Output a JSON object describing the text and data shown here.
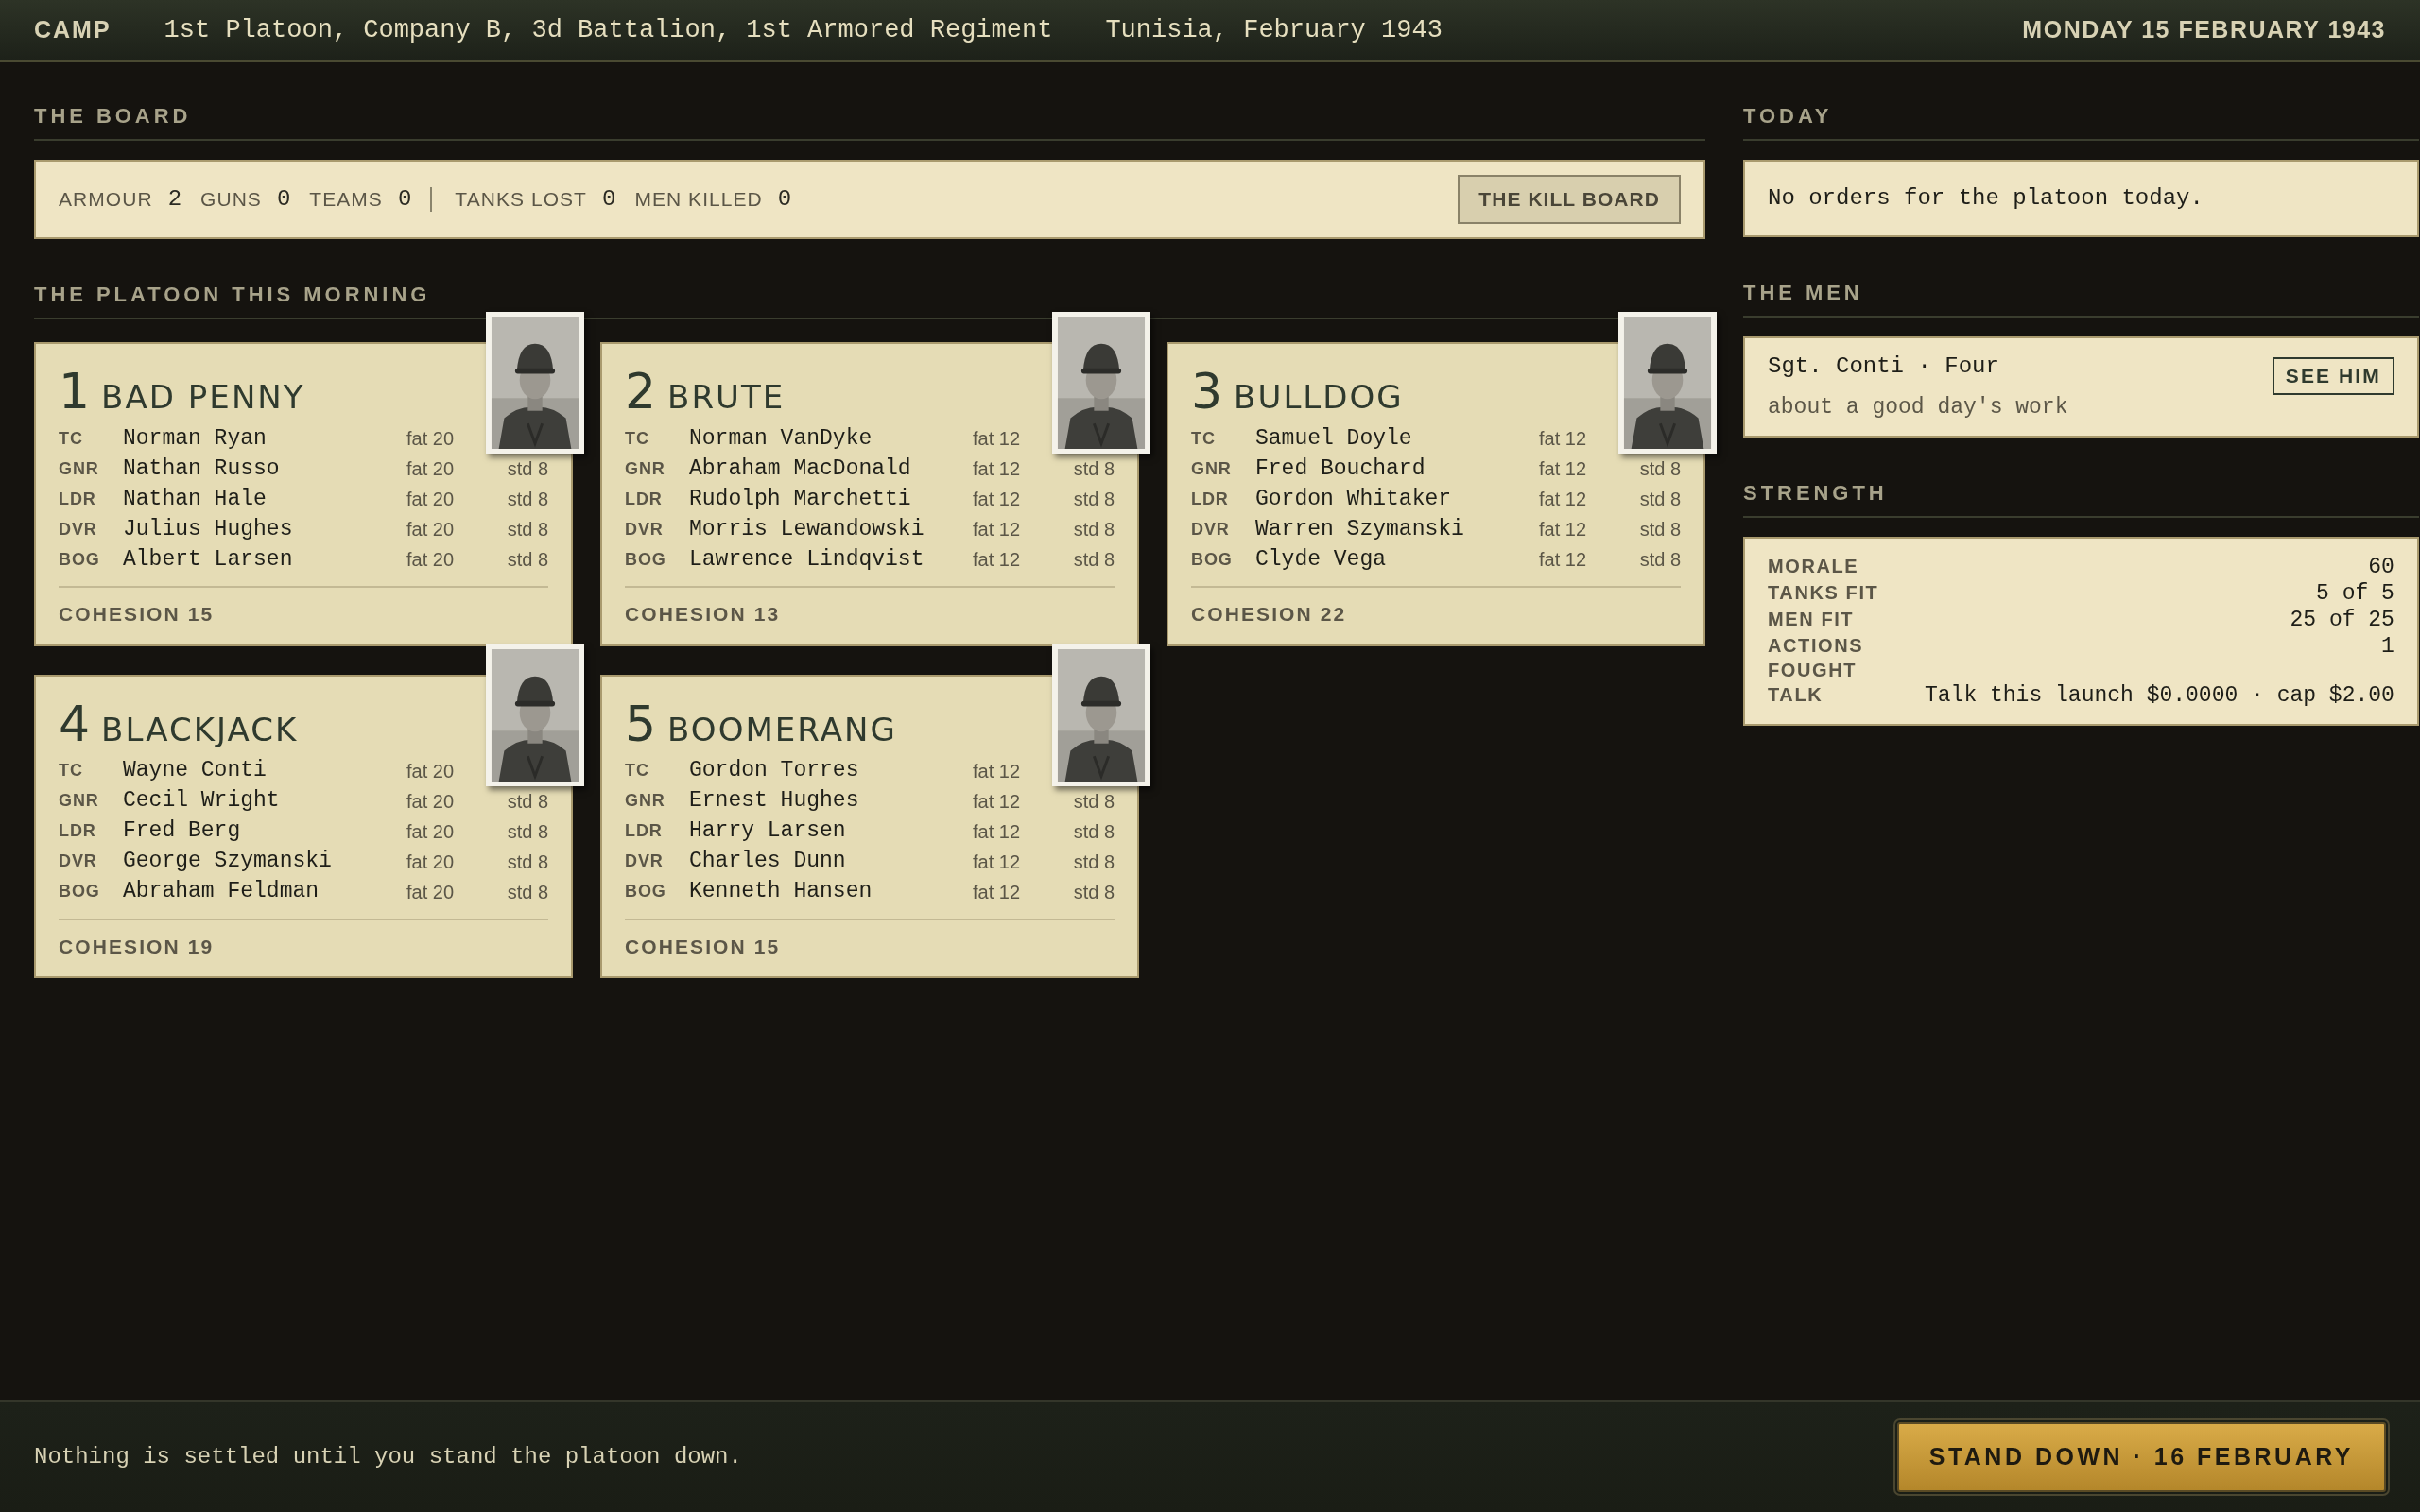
{
  "top_bar": {
    "section": "CAMP",
    "unit": "1st Platoon, Company B, 3d Battalion, 1st Armored Regiment",
    "place": "Tunisia, February 1943",
    "date": "MONDAY 15 FEBRUARY 1943"
  },
  "board": {
    "heading": "THE BOARD",
    "stats": [
      {
        "label": "ARMOUR",
        "value": "2",
        "divider_after": false
      },
      {
        "label": "GUNS",
        "value": "0",
        "divider_after": false
      },
      {
        "label": "TEAMS",
        "value": "0",
        "divider_after": true
      },
      {
        "label": "TANKS LOST",
        "value": "0",
        "divider_after": false
      },
      {
        "label": "MEN KILLED",
        "value": "0",
        "divider_after": false
      }
    ],
    "button": "THE KILL BOARD"
  },
  "platoon": {
    "heading": "THE PLATOON THIS MORNING",
    "tanks": [
      {
        "number": "1",
        "name": "BAD PENNY",
        "cohesion": "COHESION 15",
        "crew": [
          {
            "role": "TC",
            "name": "Norman Ryan",
            "fat": "fat 20"
          },
          {
            "role": "GNR",
            "name": "Nathan Russo",
            "fat": "fat 20",
            "std": "std 8"
          },
          {
            "role": "LDR",
            "name": "Nathan Hale",
            "fat": "fat 20",
            "std": "std 8"
          },
          {
            "role": "DVR",
            "name": "Julius Hughes",
            "fat": "fat 20",
            "std": "std 8"
          },
          {
            "role": "BOG",
            "name": "Albert Larsen",
            "fat": "fat 20",
            "std": "std 8"
          }
        ]
      },
      {
        "number": "2",
        "name": "BRUTE",
        "cohesion": "COHESION 13",
        "crew": [
          {
            "role": "TC",
            "name": "Norman VanDyke",
            "fat": "fat 12"
          },
          {
            "role": "GNR",
            "name": "Abraham MacDonald",
            "fat": "fat 12",
            "std": "std 8"
          },
          {
            "role": "LDR",
            "name": "Rudolph Marchetti",
            "fat": "fat 12",
            "std": "std 8"
          },
          {
            "role": "DVR",
            "name": "Morris Lewandowski",
            "fat": "fat 12",
            "std": "std 8"
          },
          {
            "role": "BOG",
            "name": "Lawrence Lindqvist",
            "fat": "fat 12",
            "std": "std 8"
          }
        ]
      },
      {
        "number": "3",
        "name": "BULLDOG",
        "cohesion": "COHESION 22",
        "crew": [
          {
            "role": "TC",
            "name": "Samuel Doyle",
            "fat": "fat 12"
          },
          {
            "role": "GNR",
            "name": "Fred Bouchard",
            "fat": "fat 12",
            "std": "std 8"
          },
          {
            "role": "LDR",
            "name": "Gordon Whitaker",
            "fat": "fat 12",
            "std": "std 8"
          },
          {
            "role": "DVR",
            "name": "Warren Szymanski",
            "fat": "fat 12",
            "std": "std 8"
          },
          {
            "role": "BOG",
            "name": "Clyde Vega",
            "fat": "fat 12",
            "std": "std 8"
          }
        ]
      },
      {
        "number": "4",
        "name": "BLACKJACK",
        "cohesion": "COHESION 19",
        "crew": [
          {
            "role": "TC",
            "name": "Wayne Conti",
            "fat": "fat 20"
          },
          {
            "role": "GNR",
            "name": "Cecil Wright",
            "fat": "fat 20",
            "std": "std 8"
          },
          {
            "role": "LDR",
            "name": "Fred Berg",
            "fat": "fat 20",
            "std": "std 8"
          },
          {
            "role": "DVR",
            "name": "George Szymanski",
            "fat": "fat 20",
            "std": "std 8"
          },
          {
            "role": "BOG",
            "name": "Abraham Feldman",
            "fat": "fat 20",
            "std": "std 8"
          }
        ]
      },
      {
        "number": "5",
        "name": "BOOMERANG",
        "cohesion": "COHESION 15",
        "crew": [
          {
            "role": "TC",
            "name": "Gordon Torres",
            "fat": "fat 12"
          },
          {
            "role": "GNR",
            "name": "Ernest Hughes",
            "fat": "fat 12",
            "std": "std 8"
          },
          {
            "role": "LDR",
            "name": "Harry Larsen",
            "fat": "fat 12",
            "std": "std 8"
          },
          {
            "role": "DVR",
            "name": "Charles Dunn",
            "fat": "fat 12",
            "std": "std 8"
          },
          {
            "role": "BOG",
            "name": "Kenneth Hansen",
            "fat": "fat 12",
            "std": "std 8"
          }
        ]
      }
    ]
  },
  "today": {
    "heading": "TODAY",
    "text": "No orders for the platoon today."
  },
  "men": {
    "heading": "THE MEN",
    "name": "Sgt. Conti · Four",
    "note": "about a good day's work",
    "button": "SEE HIM"
  },
  "strength": {
    "heading": "STRENGTH",
    "rows": [
      {
        "label": "MORALE",
        "value": "60"
      },
      {
        "label": "TANKS FIT",
        "value": "5 of 5"
      },
      {
        "label": "MEN FIT",
        "value": "25 of 25"
      },
      {
        "label": "ACTIONS FOUGHT",
        "value": "1"
      },
      {
        "label": "TALK",
        "value": "Talk this launch $0.0000 · cap $2.00"
      }
    ]
  },
  "footer": {
    "text": "Nothing is settled until you stand the platoon down.",
    "button": "STAND DOWN · 16 FEBRUARY"
  }
}
